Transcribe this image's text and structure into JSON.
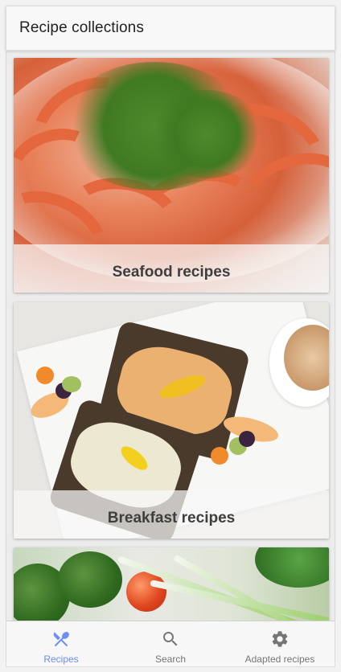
{
  "header": {
    "title": "Recipe collections"
  },
  "collections": [
    {
      "label": "Seafood recipes"
    },
    {
      "label": "Breakfast recipes"
    },
    {
      "label": ""
    }
  ],
  "bottom_nav": {
    "active": "recipes",
    "accent_color": "#6b8ef2",
    "inactive_color": "#777777",
    "items": [
      {
        "id": "recipes",
        "label": "Recipes",
        "icon": "fork-knife-icon"
      },
      {
        "id": "search",
        "label": "Search",
        "icon": "search-icon"
      },
      {
        "id": "adapted",
        "label": "Adapted recipes",
        "icon": "gear-icon"
      }
    ]
  }
}
